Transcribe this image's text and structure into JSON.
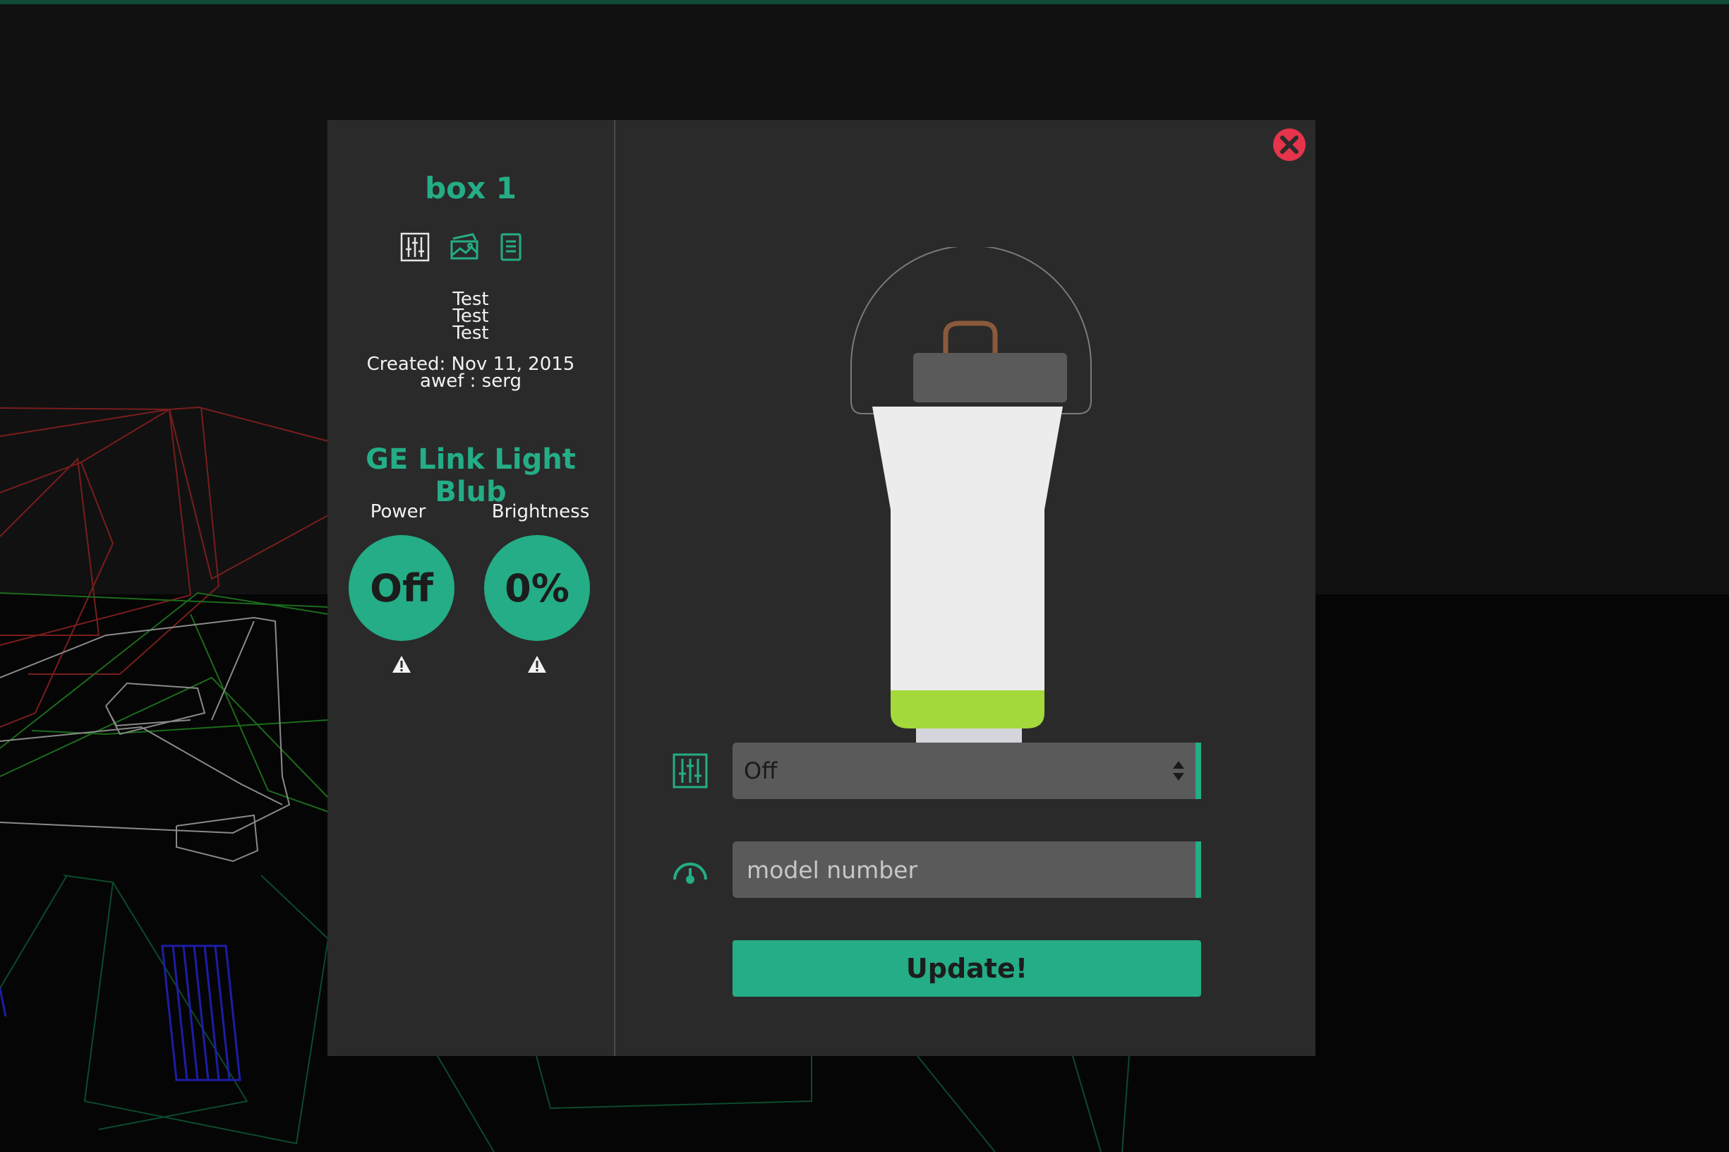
{
  "colors": {
    "accent": "#24ad86",
    "modal_bg": "#2a2a2a",
    "close": "#e5344b",
    "bulb_band": "#a3d93b"
  },
  "device": {
    "name": "box 1",
    "toolbar_icons": [
      "sliders-icon",
      "photo-icon",
      "document-icon"
    ],
    "description_lines": [
      "Test",
      "Test",
      "Test"
    ],
    "created": "Created: Nov 11, 2015",
    "meta": "awef : serg"
  },
  "product": {
    "name": "GE Link Light Blub",
    "stats": [
      {
        "label": "Power",
        "value": "Off",
        "warning_icon": "warning-icon"
      },
      {
        "label": "Brightness",
        "value": "0%",
        "warning_icon": "warning-icon"
      }
    ]
  },
  "form": {
    "mode_icon": "sliders-icon",
    "mode_value": "Off",
    "model_icon": "gauge-icon",
    "model_placeholder": "model number",
    "submit_label": "Update!"
  },
  "modal": {
    "close_icon": "close-icon"
  }
}
